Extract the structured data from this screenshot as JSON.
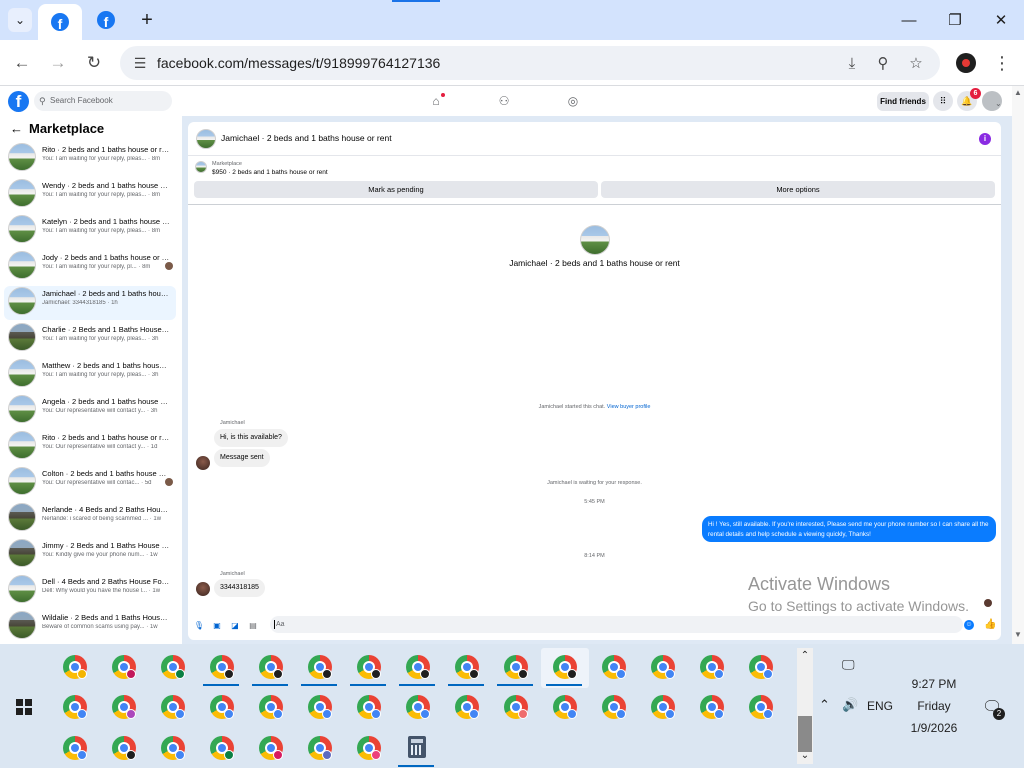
{
  "browser": {
    "url": "facebook.com/messages/t/918999764127136"
  },
  "fb_header": {
    "search_placeholder": "Search Facebook",
    "find_friends": "Find friends",
    "notifications_count": "6"
  },
  "sidebar": {
    "title": "Marketplace",
    "conversations": [
      {
        "name": "Rito · 2 beds and 1 baths house or rent",
        "preview": "You: I am waiting for your reply, pleas...",
        "time": "8m"
      },
      {
        "name": "Wendy · 2 beds and 1 baths house or rent",
        "preview": "You: I am waiting for your reply, pleas...",
        "time": "8m"
      },
      {
        "name": "Katelyn · 2 beds and 1 baths house or rent",
        "preview": "You: I am waiting for your reply, pleas...",
        "time": "8m"
      },
      {
        "name": "Jody · 2 beds and 1 baths house or rent",
        "preview": "You: I am waiting for your reply, pl...",
        "time": "8m"
      },
      {
        "name": "Jamichael · 2 beds and 1 baths house or rent",
        "preview": "Jamichael: 3344318185",
        "time": "1h"
      },
      {
        "name": "Charlie · 2 Beds and 1 Baths House for rent",
        "preview": "You: I am waiting for your reply, pleas...",
        "time": "3h"
      },
      {
        "name": "Matthew · 2 beds and 1 baths house or rent",
        "preview": "You: I am waiting for your reply, pleas...",
        "time": "3h"
      },
      {
        "name": "Angela · 2 beds and 1 baths house or rent",
        "preview": "You: Our representative will contact y...",
        "time": "3h"
      },
      {
        "name": "Rito · 2 beds and 1 baths house or rent",
        "preview": "You: Our representative will contact y...",
        "time": "1d"
      },
      {
        "name": "Colton · 2 beds and 1 baths house or rent",
        "preview": "You: Our representative will contac...",
        "time": "5d"
      },
      {
        "name": "Nerlande · 4 Beds and 2 Baths House for rent",
        "preview": "Nerlande: i scared of being scammed ...",
        "time": "1w"
      },
      {
        "name": "Jimmy · 2 Beds and 1 Baths House for rent",
        "preview": "You: Kindly give me your phone num...",
        "time": "1w"
      },
      {
        "name": "Dell · 4 Beds and 2 Baths House For rent",
        "preview": "Dell: Why would you have the house l...",
        "time": "1w"
      },
      {
        "name": "Wildalie · 2 Beds and 1 Baths House for rent",
        "preview": "Beware of common scams using pay...",
        "time": "1w"
      }
    ]
  },
  "chat": {
    "title": "Jamichael · 2 beds and 1 baths house or rent",
    "listing_source": "Marketplace",
    "listing_desc": "$950 · 2 beds and 1 baths house or rent",
    "mark_pending": "Mark as pending",
    "more_options": "More options",
    "center_title": "Jamichael · 2 beds and 1 baths house or rent",
    "started_text": "Jamichael started this chat.",
    "view_profile": "View buyer profile",
    "sender_name": "Jamichael",
    "msg1": "Hi, is this available?",
    "msg2": "Message sent",
    "waiting_text": "Jamichael is waiting for your response.",
    "time1": "5:45 PM",
    "outgoing": "Hi ! Yes, still available. If you're interested, Please send me your phone number so I can share all the rental details and help schedule a viewing quickly, Thanks!",
    "time2": "8:14 PM",
    "msg3": "3344318185",
    "composer_placeholder": "Aa"
  },
  "watermark": {
    "line1": "Activate Windows",
    "line2": "Go to Settings to activate Windows."
  },
  "taskbar": {
    "time": "9:27 PM",
    "day": "Friday",
    "date": "1/9/2026",
    "lang": "ENG",
    "notif_count": "2"
  },
  "colors": {
    "fb_blue": "#1877f2",
    "messenger_blue": "#0a7cff",
    "tab_strip": "#d3e3fd",
    "taskbar": "#dbe6f2"
  }
}
